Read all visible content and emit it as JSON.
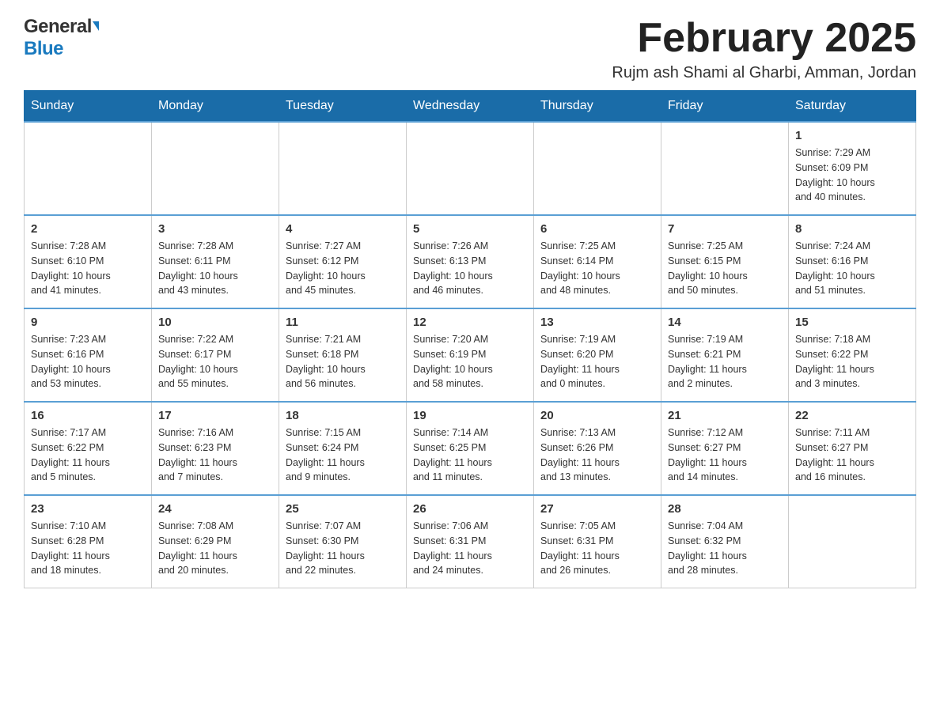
{
  "header": {
    "logo_general": "General",
    "logo_blue": "Blue",
    "month_title": "February 2025",
    "location": "Rujm ash Shami al Gharbi, Amman, Jordan"
  },
  "days_of_week": [
    "Sunday",
    "Monday",
    "Tuesday",
    "Wednesday",
    "Thursday",
    "Friday",
    "Saturday"
  ],
  "weeks": [
    {
      "cells": [
        {
          "day": "",
          "info": ""
        },
        {
          "day": "",
          "info": ""
        },
        {
          "day": "",
          "info": ""
        },
        {
          "day": "",
          "info": ""
        },
        {
          "day": "",
          "info": ""
        },
        {
          "day": "",
          "info": ""
        },
        {
          "day": "1",
          "info": "Sunrise: 7:29 AM\nSunset: 6:09 PM\nDaylight: 10 hours\nand 40 minutes."
        }
      ]
    },
    {
      "cells": [
        {
          "day": "2",
          "info": "Sunrise: 7:28 AM\nSunset: 6:10 PM\nDaylight: 10 hours\nand 41 minutes."
        },
        {
          "day": "3",
          "info": "Sunrise: 7:28 AM\nSunset: 6:11 PM\nDaylight: 10 hours\nand 43 minutes."
        },
        {
          "day": "4",
          "info": "Sunrise: 7:27 AM\nSunset: 6:12 PM\nDaylight: 10 hours\nand 45 minutes."
        },
        {
          "day": "5",
          "info": "Sunrise: 7:26 AM\nSunset: 6:13 PM\nDaylight: 10 hours\nand 46 minutes."
        },
        {
          "day": "6",
          "info": "Sunrise: 7:25 AM\nSunset: 6:14 PM\nDaylight: 10 hours\nand 48 minutes."
        },
        {
          "day": "7",
          "info": "Sunrise: 7:25 AM\nSunset: 6:15 PM\nDaylight: 10 hours\nand 50 minutes."
        },
        {
          "day": "8",
          "info": "Sunrise: 7:24 AM\nSunset: 6:16 PM\nDaylight: 10 hours\nand 51 minutes."
        }
      ]
    },
    {
      "cells": [
        {
          "day": "9",
          "info": "Sunrise: 7:23 AM\nSunset: 6:16 PM\nDaylight: 10 hours\nand 53 minutes."
        },
        {
          "day": "10",
          "info": "Sunrise: 7:22 AM\nSunset: 6:17 PM\nDaylight: 10 hours\nand 55 minutes."
        },
        {
          "day": "11",
          "info": "Sunrise: 7:21 AM\nSunset: 6:18 PM\nDaylight: 10 hours\nand 56 minutes."
        },
        {
          "day": "12",
          "info": "Sunrise: 7:20 AM\nSunset: 6:19 PM\nDaylight: 10 hours\nand 58 minutes."
        },
        {
          "day": "13",
          "info": "Sunrise: 7:19 AM\nSunset: 6:20 PM\nDaylight: 11 hours\nand 0 minutes."
        },
        {
          "day": "14",
          "info": "Sunrise: 7:19 AM\nSunset: 6:21 PM\nDaylight: 11 hours\nand 2 minutes."
        },
        {
          "day": "15",
          "info": "Sunrise: 7:18 AM\nSunset: 6:22 PM\nDaylight: 11 hours\nand 3 minutes."
        }
      ]
    },
    {
      "cells": [
        {
          "day": "16",
          "info": "Sunrise: 7:17 AM\nSunset: 6:22 PM\nDaylight: 11 hours\nand 5 minutes."
        },
        {
          "day": "17",
          "info": "Sunrise: 7:16 AM\nSunset: 6:23 PM\nDaylight: 11 hours\nand 7 minutes."
        },
        {
          "day": "18",
          "info": "Sunrise: 7:15 AM\nSunset: 6:24 PM\nDaylight: 11 hours\nand 9 minutes."
        },
        {
          "day": "19",
          "info": "Sunrise: 7:14 AM\nSunset: 6:25 PM\nDaylight: 11 hours\nand 11 minutes."
        },
        {
          "day": "20",
          "info": "Sunrise: 7:13 AM\nSunset: 6:26 PM\nDaylight: 11 hours\nand 13 minutes."
        },
        {
          "day": "21",
          "info": "Sunrise: 7:12 AM\nSunset: 6:27 PM\nDaylight: 11 hours\nand 14 minutes."
        },
        {
          "day": "22",
          "info": "Sunrise: 7:11 AM\nSunset: 6:27 PM\nDaylight: 11 hours\nand 16 minutes."
        }
      ]
    },
    {
      "cells": [
        {
          "day": "23",
          "info": "Sunrise: 7:10 AM\nSunset: 6:28 PM\nDaylight: 11 hours\nand 18 minutes."
        },
        {
          "day": "24",
          "info": "Sunrise: 7:08 AM\nSunset: 6:29 PM\nDaylight: 11 hours\nand 20 minutes."
        },
        {
          "day": "25",
          "info": "Sunrise: 7:07 AM\nSunset: 6:30 PM\nDaylight: 11 hours\nand 22 minutes."
        },
        {
          "day": "26",
          "info": "Sunrise: 7:06 AM\nSunset: 6:31 PM\nDaylight: 11 hours\nand 24 minutes."
        },
        {
          "day": "27",
          "info": "Sunrise: 7:05 AM\nSunset: 6:31 PM\nDaylight: 11 hours\nand 26 minutes."
        },
        {
          "day": "28",
          "info": "Sunrise: 7:04 AM\nSunset: 6:32 PM\nDaylight: 11 hours\nand 28 minutes."
        },
        {
          "day": "",
          "info": ""
        }
      ]
    }
  ]
}
